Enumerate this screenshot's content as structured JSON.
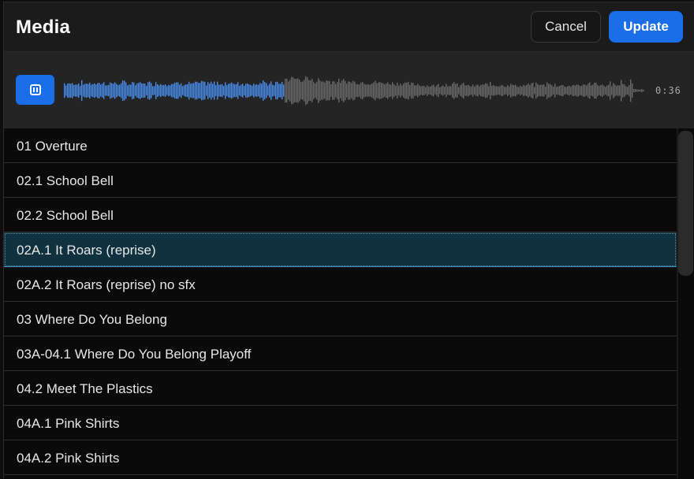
{
  "header": {
    "title": "Media",
    "cancel_label": "Cancel",
    "update_label": "Update"
  },
  "player": {
    "state": "playing",
    "time": "0:36",
    "played_fraction": 0.38,
    "colors": {
      "played": "#4a8ef0",
      "unplayed": "#6a6a6a"
    }
  },
  "tracks": [
    {
      "label": "01 Overture",
      "selected": false
    },
    {
      "label": "02.1 School Bell",
      "selected": false
    },
    {
      "label": "02.2 School Bell",
      "selected": false
    },
    {
      "label": "02A.1 It Roars (reprise)",
      "selected": true
    },
    {
      "label": "02A.2 It Roars (reprise) no sfx",
      "selected": false
    },
    {
      "label": "03 Where Do You Belong",
      "selected": false
    },
    {
      "label": "03A-04.1 Where Do You Belong Playoff",
      "selected": false
    },
    {
      "label": "04.2 Meet The Plastics",
      "selected": false
    },
    {
      "label": "04A.1 Pink Shirts",
      "selected": false
    },
    {
      "label": "04A.2 Pink Shirts",
      "selected": false
    }
  ],
  "colors": {
    "accent": "#1a6ee8",
    "selected_row": "#10313f",
    "background": "#0a0a0a"
  }
}
